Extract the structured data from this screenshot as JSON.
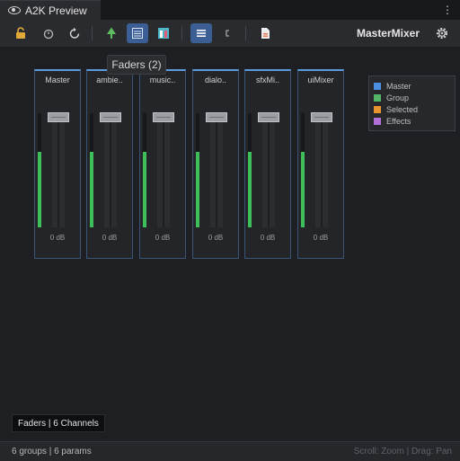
{
  "window": {
    "tab_title": "A2K Preview",
    "menu_icon": "kebab-menu-icon"
  },
  "toolbar": {
    "buttons": [
      {
        "icon": "lock-icon"
      },
      {
        "icon": "timer-icon"
      },
      {
        "icon": "refresh-icon"
      },
      {
        "icon": "tree-icon"
      },
      {
        "icon": "faders-view-icon",
        "active": true
      },
      {
        "icon": "grid-view-icon"
      },
      {
        "icon": "list-icon",
        "active": true
      },
      {
        "icon": "bracket-icon"
      },
      {
        "icon": "document-icon"
      }
    ],
    "mixer_name": "MasterMixer",
    "settings_icon": "gear-icon"
  },
  "tooltip": "Faders (2)",
  "strips": [
    {
      "name": "Master",
      "level": 0.66,
      "db": "0 dB"
    },
    {
      "name": "ambie..",
      "level": 0.66,
      "db": "0 dB"
    },
    {
      "name": "music..",
      "level": 0.66,
      "db": "0 dB"
    },
    {
      "name": "dialo..",
      "level": 0.66,
      "db": "0 dB"
    },
    {
      "name": "sfxMi..",
      "level": 0.66,
      "db": "0 dB"
    },
    {
      "name": "uiMixer",
      "level": 0.66,
      "db": "0 dB"
    }
  ],
  "legend": [
    {
      "label": "Master",
      "color": "#4a8fe0"
    },
    {
      "label": "Group",
      "color": "#52b465"
    },
    {
      "label": "Selected",
      "color": "#e6952e"
    },
    {
      "label": "Effects",
      "color": "#b070d8"
    }
  ],
  "overlay_label": "Faders | 6 Channels",
  "status": {
    "left": "6 groups | 6 params",
    "right": "Scroll: Zoom | Drag: Pan"
  },
  "colors": {
    "accent": "#5b9bdc",
    "meter": "#3fbf5a",
    "active_button": "#3b5e94"
  }
}
